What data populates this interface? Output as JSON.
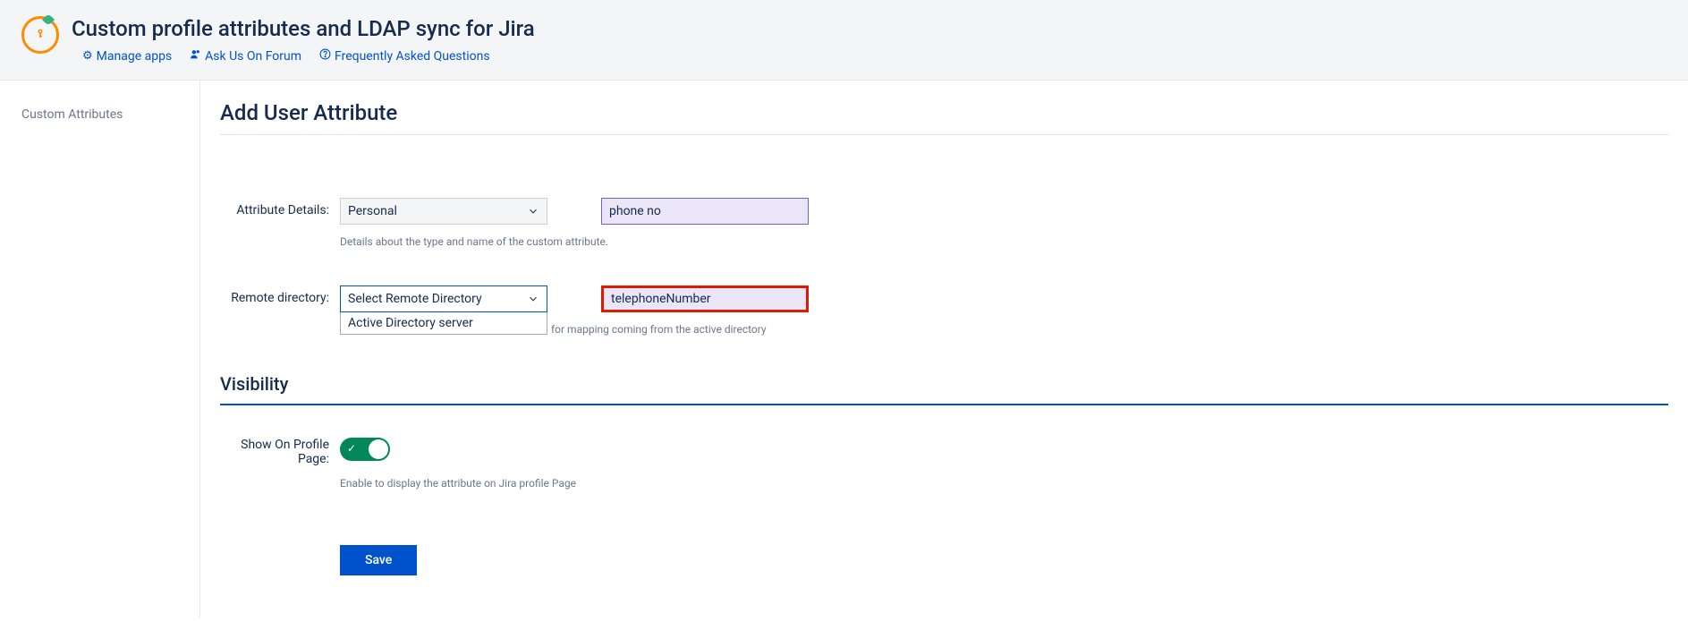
{
  "header": {
    "title": "Custom profile attributes and LDAP sync for Jira",
    "links": {
      "manage_apps": "Manage apps",
      "ask_forum": "Ask Us On Forum",
      "faq": "Frequently Asked Questions"
    }
  },
  "sidebar": {
    "custom_attributes": "Custom Attributes"
  },
  "main": {
    "page_title": "Add User Attribute",
    "attribute_details": {
      "label": "Attribute Details:",
      "type_value": "Personal",
      "name_value": "phone no",
      "help": "Details about the type and name of the custom attribute."
    },
    "remote_directory": {
      "label": "Remote directory:",
      "select_value": "Select Remote Directory",
      "dropdown_option": "Active Directory server",
      "mapping_value": "telephoneNumber",
      "help": "for mapping coming from the active directory"
    },
    "visibility": {
      "section_title": "Visibility",
      "show_profile_label": "Show On Profile Page:",
      "help": "Enable to display the attribute on Jira profile Page"
    },
    "save_button": "Save"
  }
}
